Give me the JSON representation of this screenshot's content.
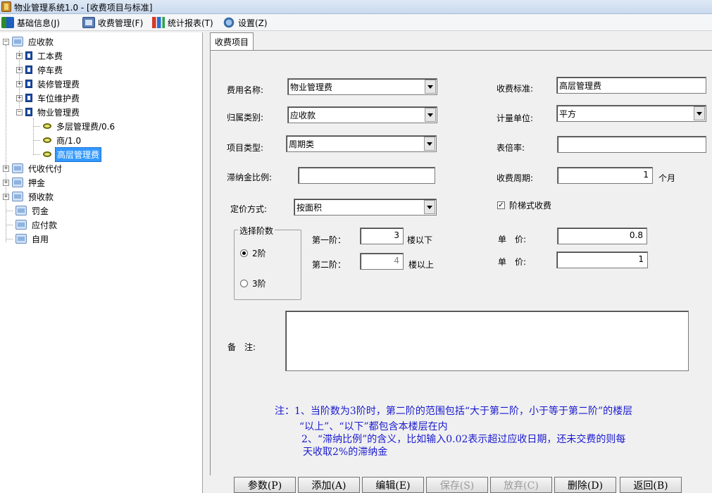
{
  "window": {
    "title": "物业管理系统1.0 - [收费项目与标准]"
  },
  "menu": [
    {
      "label": "基础信息(J)",
      "icon": "basic-info-icon"
    },
    {
      "label": "收费管理(F)",
      "icon": "fee-management-icon"
    },
    {
      "label": "统计报表(T)",
      "icon": "statistics-icon"
    },
    {
      "label": "设置(Z)",
      "icon": "settings-icon"
    }
  ],
  "tree": {
    "receivable": "应收款",
    "children": [
      "工本费",
      "停车费",
      "装修管理费",
      "车位维护费",
      "物业管理费"
    ],
    "property_children": [
      "多层管理费/0.6",
      "商/1.0",
      "高层管理费"
    ],
    "others": [
      "代收代付",
      "押金",
      "预收款",
      "罚金",
      "应付款",
      "自用"
    ]
  },
  "tab": {
    "label": "收费项目"
  },
  "form": {
    "fee_name_label": "费用名称:",
    "fee_name_value": "物业管理费",
    "category_label": "归属类别:",
    "category_value": "应收款",
    "item_type_label": "项目类型:",
    "item_type_value": "周期类",
    "late_fee_label": "滞纳金比例:",
    "late_fee_value": "",
    "pricing_label": "定价方式:",
    "pricing_value": "按面积",
    "standard_label": "收费标准:",
    "standard_value": "高层管理费",
    "unit_label": "计量单位:",
    "unit_value": "平方",
    "meter_rate_label": "表倍率:",
    "meter_rate_value": "",
    "period_label": "收费周期:",
    "period_value": "1",
    "period_unit": "个月",
    "tiered_label": "阶梯式收费",
    "tiered_checked": "☑",
    "tiers_group_title": "选择阶数",
    "tier_2_label": "2阶",
    "tier_3_label": "3阶",
    "tier1_label": "第一阶：",
    "tier1_value": "3",
    "tier1_suffix": "楼以下",
    "tier2_label": "第二阶：",
    "tier2_value": "4",
    "tier2_suffix": "楼以上",
    "price1_label": "单　价:",
    "price1_value": "0.8",
    "price2_label": "单　价:",
    "price2_value": "1",
    "remarks_label": "备　注:",
    "remarks_value": ""
  },
  "notes": [
    "注：1、当阶数为3阶时，第二阶的范围包括“大于第二阶，小于等于第二阶”的楼层",
    "“以上”、“以下”都包含本楼层在内",
    "2、“滞纳比例”的含义，比如输入0.02表示超过应收日期，还未交费的则每",
    "天收取2%的滞纳金"
  ],
  "buttons": {
    "params": "参数(P)",
    "add": "添加(A)",
    "edit": "编辑(E)",
    "save": "保存(S)",
    "discard": "放弃(C)",
    "delete": "删除(D)",
    "back": "返回(B)"
  }
}
